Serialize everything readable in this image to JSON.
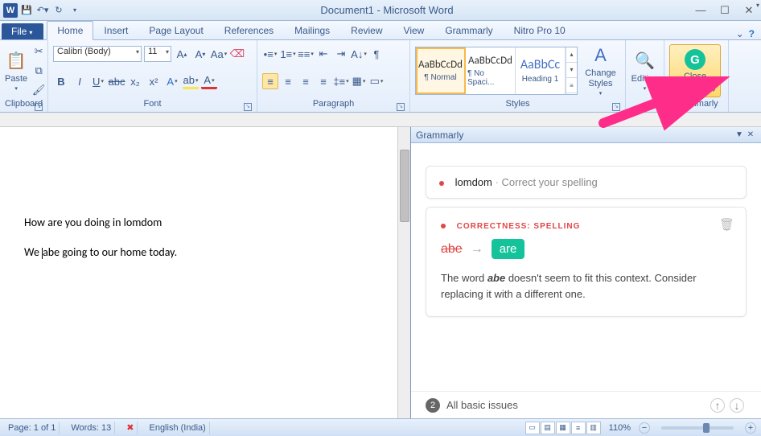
{
  "title": "Document1 - Microsoft Word",
  "tabs": {
    "file": "File",
    "items": [
      "Home",
      "Insert",
      "Page Layout",
      "References",
      "Mailings",
      "Review",
      "View",
      "Grammarly",
      "Nitro Pro 10"
    ],
    "active": 0
  },
  "ribbon": {
    "clipboard": {
      "paste": "Paste",
      "label": "Clipboard"
    },
    "font": {
      "name": "Calibri (Body)",
      "size": "11",
      "label": "Font"
    },
    "paragraph": {
      "label": "Paragraph"
    },
    "styles": {
      "label": "Styles",
      "items": [
        {
          "preview": "AaBbCcDd",
          "name": "¶ Normal",
          "selected": true
        },
        {
          "preview": "AaBbCcDd",
          "name": "¶ No Spaci..."
        },
        {
          "preview": "AaBbCc",
          "name": "Heading 1",
          "big": true
        }
      ],
      "change": "Change Styles"
    },
    "editing": {
      "label": "Editing"
    },
    "grammarly": {
      "close": "Close Grammarly",
      "label": "Grammarly"
    }
  },
  "document": {
    "line1_a": "How are you doing in ",
    "line1_b": "lomdom",
    "line2_a": "We ",
    "line2_b": "abe",
    "line2_c": " going to our home today."
  },
  "grampane": {
    "title": "Grammarly",
    "card1": {
      "word": "lomdom",
      "hint": "Correct your spelling"
    },
    "card2": {
      "category": "CORRECTNESS: SPELLING",
      "bad": "abe",
      "good": "are",
      "text_a": "The word ",
      "text_b": "abe",
      "text_c": " doesn't seem to fit this context. Consider replacing it with a different one."
    },
    "footer": {
      "count": "2",
      "text": "All basic issues"
    }
  },
  "status": {
    "page": "Page: 1 of 1",
    "words": "Words: 13",
    "lang": "English (India)",
    "zoom": "110%"
  }
}
